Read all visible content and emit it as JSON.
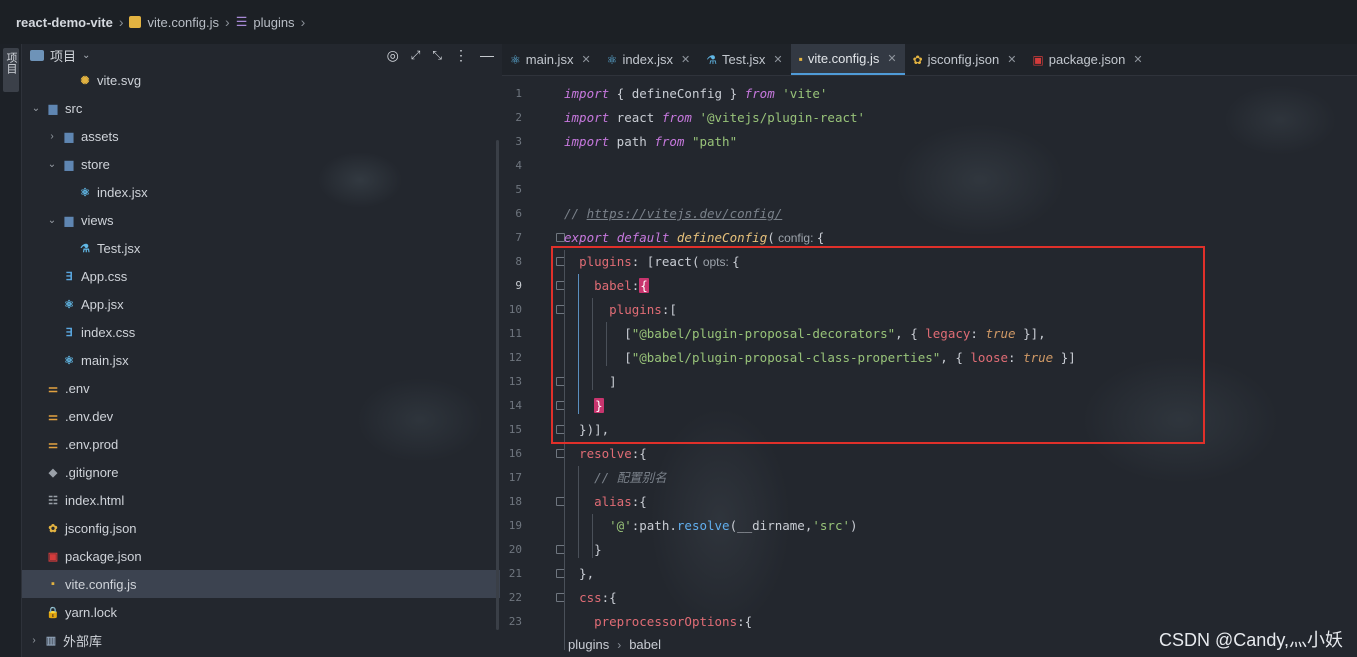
{
  "breadcrumb": {
    "project": "react-demo-vite",
    "file": "vite.config.js",
    "symbol": "plugins"
  },
  "left_strip": {
    "label": "项目",
    "icon": "structure-icon"
  },
  "project_panel": {
    "title": "项目",
    "tools": [
      "target-icon",
      "expand-icon",
      "collapse-icon",
      "more-icon",
      "minimize-icon"
    ]
  },
  "tree": [
    {
      "label": "vite.svg",
      "icon": "svg-icon",
      "depth": 3,
      "chevron": ""
    },
    {
      "label": "src",
      "icon": "folder-icon",
      "depth": 1,
      "chevron": "open"
    },
    {
      "label": "assets",
      "icon": "folder-icon",
      "depth": 2,
      "chevron": "closed"
    },
    {
      "label": "store",
      "icon": "folder-icon",
      "depth": 2,
      "chevron": "open"
    },
    {
      "label": "index.jsx",
      "icon": "react-icon",
      "depth": 3,
      "chevron": ""
    },
    {
      "label": "views",
      "icon": "folder-icon",
      "depth": 2,
      "chevron": "open"
    },
    {
      "label": "Test.jsx",
      "icon": "jsx-icon",
      "depth": 3,
      "chevron": ""
    },
    {
      "label": "App.css",
      "icon": "css-icon",
      "depth": 2,
      "chevron": ""
    },
    {
      "label": "App.jsx",
      "icon": "react-icon",
      "depth": 2,
      "chevron": ""
    },
    {
      "label": "index.css",
      "icon": "css-icon",
      "depth": 2,
      "chevron": ""
    },
    {
      "label": "main.jsx",
      "icon": "react-icon",
      "depth": 2,
      "chevron": ""
    },
    {
      "label": ".env",
      "icon": "env-icon",
      "depth": 1,
      "chevron": ""
    },
    {
      "label": ".env.dev",
      "icon": "env-icon",
      "depth": 1,
      "chevron": ""
    },
    {
      "label": ".env.prod",
      "icon": "env-icon",
      "depth": 1,
      "chevron": ""
    },
    {
      "label": ".gitignore",
      "icon": "gitignore-icon",
      "depth": 1,
      "chevron": ""
    },
    {
      "label": "index.html",
      "icon": "html-icon",
      "depth": 1,
      "chevron": ""
    },
    {
      "label": "jsconfig.json",
      "icon": "json-icon",
      "depth": 1,
      "chevron": ""
    },
    {
      "label": "package.json",
      "icon": "npm-icon",
      "depth": 1,
      "chevron": ""
    },
    {
      "label": "vite.config.js",
      "icon": "js-icon",
      "depth": 1,
      "chevron": "",
      "selected": true
    },
    {
      "label": "yarn.lock",
      "icon": "lock-icon",
      "depth": 1,
      "chevron": ""
    }
  ],
  "external_libs": "外部库",
  "tabs": [
    {
      "label": "main.jsx",
      "icon": "react-icon",
      "active": false
    },
    {
      "label": "index.jsx",
      "icon": "react-icon",
      "active": false
    },
    {
      "label": "Test.jsx",
      "icon": "jsx-icon",
      "active": false
    },
    {
      "label": "vite.config.js",
      "icon": "js-icon",
      "active": true
    },
    {
      "label": "jsconfig.json",
      "icon": "json-icon",
      "active": false
    },
    {
      "label": "package.json",
      "icon": "npm-icon",
      "active": false
    }
  ],
  "editor": {
    "current_line": 9,
    "lines": [
      "import { defineConfig } from 'vite'",
      "import react from '@vitejs/plugin-react'",
      "import path from \"path\"",
      "",
      "",
      "// https://vitejs.dev/config/",
      "export default defineConfig( config: {",
      "  plugins: [react( opts: {",
      "    babel:{",
      "      plugins:[",
      "        [\"@babel/plugin-proposal-decorators\", { legacy: true }],",
      "        [\"@babel/plugin-proposal-class-properties\", { loose: true }]",
      "      ]",
      "    }",
      "  })],",
      "  resolve:{",
      "    // 配置别名",
      "    alias:{",
      "      '@':path.resolve(__dirname,'src')",
      "    }",
      "  },",
      "  css:{",
      "    preprocessorOptions:{"
    ]
  },
  "bottom_breadcrumb": [
    "plugins",
    "babel"
  ],
  "watermark": "CSDN @Candy,灬小妖",
  "colors": {
    "highlight_box": "#e0302a",
    "bracket_highlight": "#c8356e",
    "accent": "#4f9bd8"
  }
}
